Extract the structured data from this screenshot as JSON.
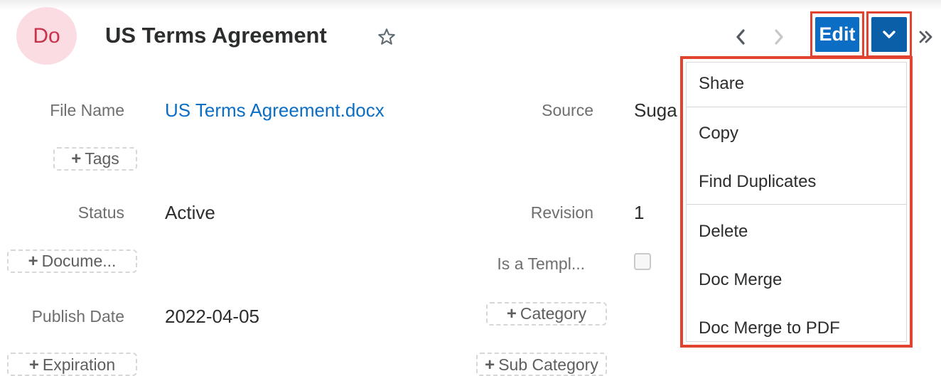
{
  "record": {
    "avatar_initials": "Do",
    "title": "US Terms Agreement"
  },
  "header": {
    "edit_label": "Edit",
    "icons": {
      "favorite": "star-icon",
      "previous": "chevron-left-icon",
      "next": "chevron-right-icon",
      "actions": "chevron-down-icon",
      "expand": "double-chevron-right-icon"
    }
  },
  "fields": {
    "file_name_label": "File Name",
    "file_name_value": "US Terms Agreement.docx",
    "source_label": "Source",
    "source_value": "Suga",
    "tags_pill": "Tags",
    "status_label": "Status",
    "status_value": "Active",
    "revision_label": "Revision",
    "revision_value": "1",
    "document_pill": "Docume...",
    "is_template_label": "Is a Templ...",
    "publish_date_label": "Publish Date",
    "publish_date_value": "2022-04-05",
    "category_pill": "Category",
    "expiration_pill": "Expiration",
    "subcategory_pill": "Sub Category"
  },
  "actions_menu": {
    "items": [
      "Share",
      "Copy",
      "Find Duplicates",
      "Delete",
      "Doc Merge",
      "Doc Merge to PDF"
    ]
  },
  "colors": {
    "primary_button": "#0b6ec4",
    "highlight_outline": "#e0432f",
    "link": "#0b6ec4",
    "avatar_bg": "#fbdce3",
    "avatar_text": "#c8324b"
  }
}
